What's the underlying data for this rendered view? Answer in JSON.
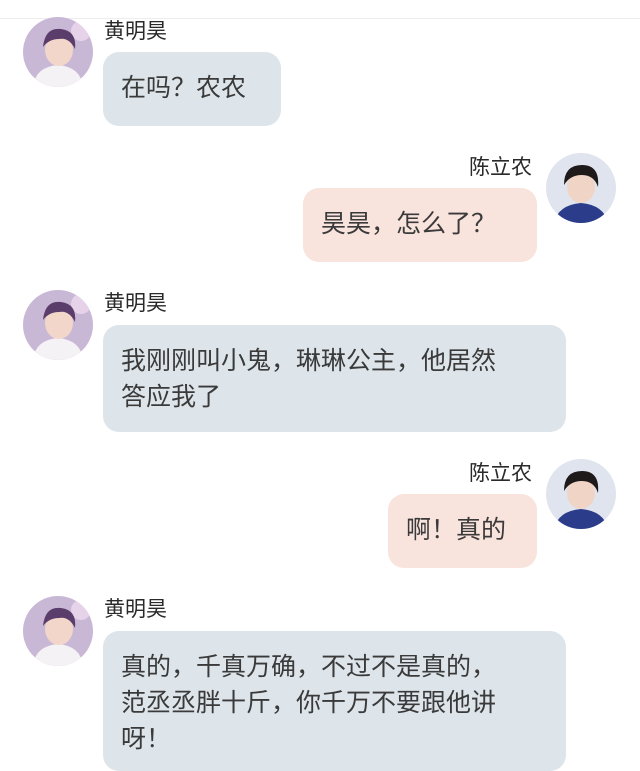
{
  "colors": {
    "left_bubble": "#dde5eb",
    "right_bubble": "#f9e3dd",
    "name_text": "#2a2a2a",
    "message_text": "#3a3a3a"
  },
  "messages": [
    {
      "sender": "黄明昊",
      "side": "left",
      "avatar_icon": "avatar-huang-minghao-icon",
      "lines": [
        "在吗？农农"
      ]
    },
    {
      "sender": "陈立农",
      "side": "right",
      "avatar_icon": "avatar-chen-linong-icon",
      "lines": [
        "昊昊，怎么了？"
      ]
    },
    {
      "sender": "黄明昊",
      "side": "left",
      "avatar_icon": "avatar-huang-minghao-icon",
      "lines": [
        "我刚刚叫小鬼，琳琳公主，他居然",
        "答应我了"
      ]
    },
    {
      "sender": "陈立农",
      "side": "right",
      "avatar_icon": "avatar-chen-linong-icon",
      "lines": [
        "啊！真的"
      ]
    },
    {
      "sender": "黄明昊",
      "side": "left",
      "avatar_icon": "avatar-huang-minghao-icon",
      "lines": [
        "真的，千真万确，不过不是真的，",
        "范丞丞胖十斤，你千万不要跟他讲",
        "呀！"
      ]
    }
  ]
}
